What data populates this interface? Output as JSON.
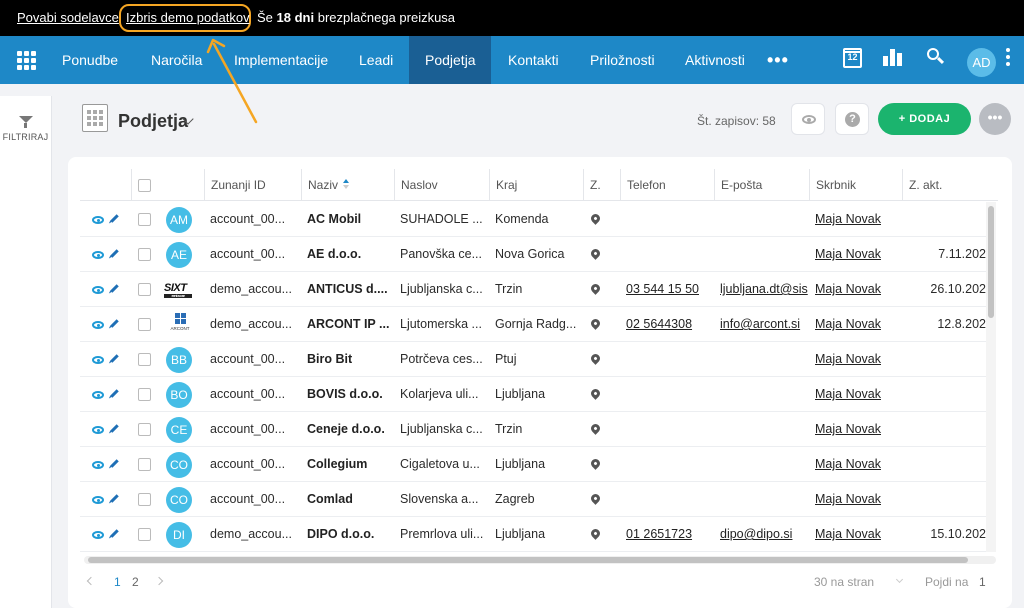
{
  "banner": {
    "invite": "Povabi sodelavce",
    "delete_demo": "Izbris demo podatkov",
    "trial_prefix": "Še",
    "trial_days": "18 dni",
    "trial_suffix": "brezplačnega preizkusa"
  },
  "nav": {
    "items": [
      "Ponudbe",
      "Naročila",
      "Implementacije",
      "Leadi",
      "Podjetja",
      "Kontakti",
      "Priložnosti",
      "Aktivnosti"
    ],
    "active": "Podjetja",
    "more": "•••",
    "calendar_day": "12",
    "avatar": "AD"
  },
  "sidebar": {
    "filter_label": "FILTRIRAJ"
  },
  "header": {
    "title": "Podjetja",
    "record_count": "Št. zapisov: 58",
    "add_label": "+  DODAJ",
    "more": "•••",
    "help": "?"
  },
  "table": {
    "columns": [
      "Zunanji ID",
      "Naziv",
      "Naslov",
      "Kraj",
      "Z.",
      "Telefon",
      "E-pošta",
      "Skrbnik",
      "Z. akt."
    ],
    "rows": [
      {
        "avatar": "AM",
        "ext_id": "account_00...",
        "name": "AC Mobil",
        "address": "SUHADOLE ...",
        "city": "Komenda",
        "phone": "",
        "email": "",
        "owner": "Maja Novak",
        "last": ""
      },
      {
        "avatar": "AE",
        "ext_id": "account_00...",
        "name": "AE d.o.o.",
        "address": "Panovška ce...",
        "city": "Nova Gorica",
        "phone": "",
        "email": "",
        "owner": "Maja Novak",
        "last": "7.11.202"
      },
      {
        "avatar": "",
        "logo": "sixt",
        "ext_id": "demo_accou...",
        "name": "ANTICUS d....",
        "address": "Ljubljanska c...",
        "city": "Trzin",
        "phone": "03 544 15 50",
        "email": "ljubljana.dt@sis",
        "owner": "Maja Novak",
        "last": "26.10.202"
      },
      {
        "avatar": "",
        "logo": "arcont",
        "ext_id": "demo_accou...",
        "name": "ARCONT IP ...",
        "address": "Ljutomerska ...",
        "city": "Gornja Radg...",
        "phone": "02 5644308",
        "email": "info@arcont.si",
        "owner": "Maja Novak",
        "last": "12.8.202"
      },
      {
        "avatar": "BB",
        "ext_id": "account_00...",
        "name": "Biro Bit",
        "address": "Potrčeva ces...",
        "city": "Ptuj",
        "phone": "",
        "email": "",
        "owner": "Maja Novak",
        "last": ""
      },
      {
        "avatar": "BO",
        "ext_id": "account_00...",
        "name": "BOVIS d.o.o.",
        "address": "Kolarjeva uli...",
        "city": "Ljubljana",
        "phone": "",
        "email": "",
        "owner": "Maja Novak",
        "last": ""
      },
      {
        "avatar": "CE",
        "ext_id": "account_00...",
        "name": "Ceneje d.o.o.",
        "address": "Ljubljanska c...",
        "city": "Trzin",
        "phone": "",
        "email": "",
        "owner": "Maja Novak",
        "last": ""
      },
      {
        "avatar": "CO",
        "ext_id": "account_00...",
        "name": "Collegium",
        "address": "Cigaletova u...",
        "city": "Ljubljana",
        "phone": "",
        "email": "",
        "owner": "Maja Novak",
        "last": ""
      },
      {
        "avatar": "CO",
        "ext_id": "account_00...",
        "name": "Comlad",
        "address": "Slovenska a...",
        "city": "Zagreb",
        "phone": "",
        "email": "",
        "owner": "Maja Novak",
        "last": ""
      },
      {
        "avatar": "DI",
        "ext_id": "demo_accou...",
        "name": "DIPO d.o.o.",
        "address": "Premrlova uli...",
        "city": "Ljubljana",
        "phone": "01 2651723",
        "email": "dipo@dipo.si",
        "owner": "Maja Novak",
        "last": "15.10.202"
      }
    ],
    "logos": {
      "sixt": "SIXT",
      "sixt_sub": "rent a car",
      "arcont": "ARCONT"
    }
  },
  "pager": {
    "pages": [
      "1",
      "2"
    ],
    "current": "1",
    "per_page": "30 na stran",
    "goto_label": "Pojdi na",
    "goto_value": "1"
  },
  "colors": {
    "nav": "#1e88c7",
    "nav_active": "#1a5f94",
    "add": "#1bb46e",
    "avatar": "#45bde6",
    "annotation": "#f5a623"
  }
}
